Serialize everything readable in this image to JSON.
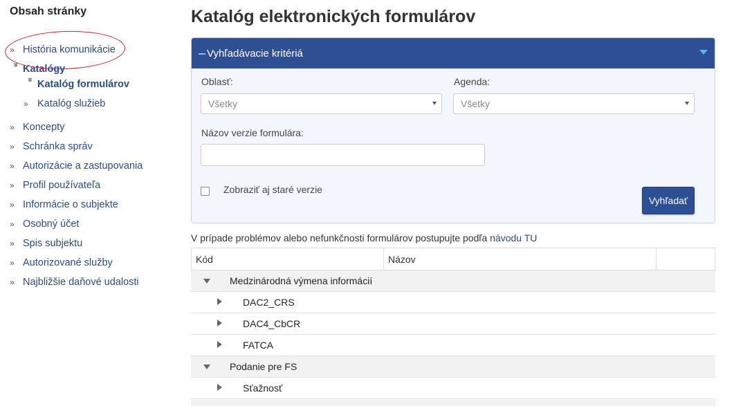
{
  "sidebar": {
    "title": "Obsah stránky",
    "items": [
      {
        "label": "História komunikácie"
      },
      {
        "label": "Katalógy"
      },
      {
        "label": "Katalóg formulárov"
      },
      {
        "label": "Katalóg služieb"
      },
      {
        "label": "Koncepty"
      },
      {
        "label": "Schránka správ"
      },
      {
        "label": "Autorizácie a zastupovania"
      },
      {
        "label": "Profil používateľa"
      },
      {
        "label": "Informácie o subjekte"
      },
      {
        "label": "Osobný účet"
      },
      {
        "label": "Spis subjektu"
      },
      {
        "label": "Autorizované služby"
      },
      {
        "label": "Najbližšie daňové udalosti"
      }
    ]
  },
  "main": {
    "title": "Katalóg elektronických formulárov",
    "criteria": {
      "header": "Vyhľadávacie kritériá",
      "oblast_label": "Oblasť:",
      "oblast_value": "Všetky",
      "agenda_label": "Agenda:",
      "agenda_value": "Všetky",
      "nazov_label": "Názov verzie formulára:",
      "nazov_value": "",
      "old_versions_label": "Zobraziť aj staré verzie",
      "search_label": "Vyhľadať"
    },
    "info_text": "V prípade problémov alebo nefunkčnosti formulárov postupujte podľa ",
    "info_link": "návodu TU",
    "table": {
      "headers": [
        "Kód",
        "Názov"
      ],
      "rows": [
        {
          "label": "Medzinárodná výmena informácií"
        },
        {
          "label": "DAC2_CRS"
        },
        {
          "label": "DAC4_CbCR"
        },
        {
          "label": "FATCA"
        },
        {
          "label": "Podanie pre FS"
        },
        {
          "label": "Sťažnosť"
        }
      ]
    }
  },
  "colors": {
    "primary": "#2e4f93",
    "link": "#2b4b89",
    "annotation": "#d71d1d"
  }
}
